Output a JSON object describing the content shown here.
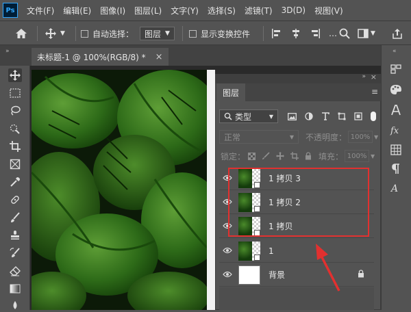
{
  "app": {
    "logo": "Ps"
  },
  "menu": [
    "文件(F)",
    "编辑(E)",
    "图像(I)",
    "图层(L)",
    "文字(Y)",
    "选择(S)",
    "滤镜(T)",
    "3D(D)",
    "视图(V)"
  ],
  "options": {
    "auto_select_label": "自动选择：",
    "auto_select_value": "图层",
    "show_transform_label": "显示变换控件"
  },
  "document_tab": {
    "title": "未标题-1 @ 100%(RGB/8) *",
    "close": "×"
  },
  "panel": {
    "tab_label": "图层",
    "filter_kind": "类型",
    "blend_mode": "正常",
    "opacity_label": "不透明度：",
    "opacity_value": "100%",
    "lock_label": "锁定：",
    "fill_label": "填充：",
    "fill_value": "100%",
    "layers": [
      {
        "name": "1 拷贝 3",
        "visible": true,
        "selected_group": true
      },
      {
        "name": "1 拷贝 2",
        "visible": true,
        "selected_group": true
      },
      {
        "name": "1 拷贝",
        "visible": true,
        "selected_group": true
      },
      {
        "name": "1",
        "visible": true,
        "selected_group": false
      },
      {
        "name": "背景",
        "visible": true,
        "locked": true
      }
    ]
  },
  "colors": {
    "highlight": "#e2302f",
    "arrow": "#e2302f",
    "accent": "#31a8ff"
  }
}
